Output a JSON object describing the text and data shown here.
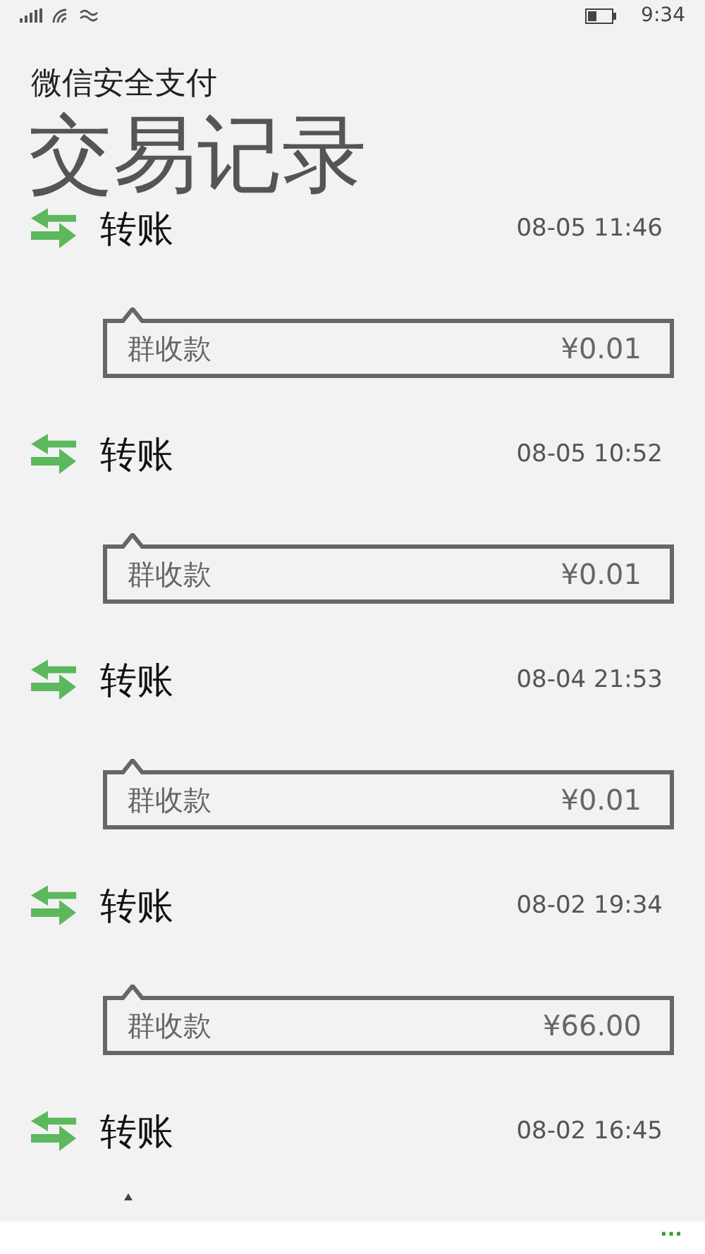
{
  "status_bar": {
    "time": "9:34"
  },
  "header": {
    "subtitle": "微信安全支付",
    "title": "交易记录"
  },
  "transactions": [
    {
      "title": "转账",
      "time": "08-05 11:46",
      "note": {
        "label": "群收款",
        "amount": "¥0.01"
      }
    },
    {
      "title": "转账",
      "time": "08-05 10:52",
      "note": {
        "label": "群收款",
        "amount": "¥0.01"
      }
    },
    {
      "title": "转账",
      "time": "08-04 21:53",
      "note": {
        "label": "群收款",
        "amount": "¥0.01"
      }
    },
    {
      "title": "转账",
      "time": "08-02 19:34",
      "note": {
        "label": "群收款",
        "amount": "¥66.00"
      }
    },
    {
      "title": "转账",
      "time": "08-02 16:45"
    }
  ],
  "app_bar": {
    "more": "..."
  }
}
